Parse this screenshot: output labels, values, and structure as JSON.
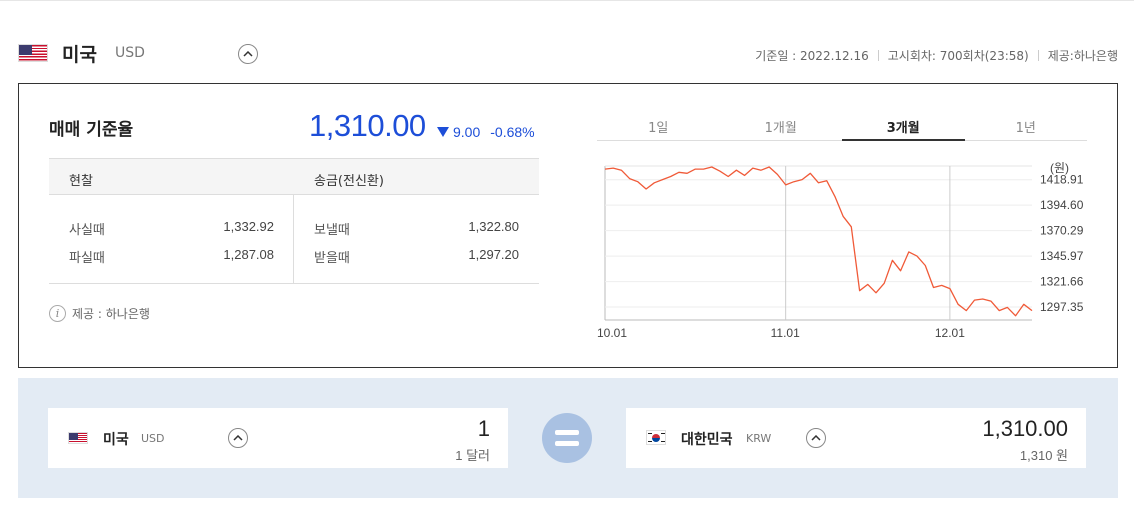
{
  "header": {
    "country": "미국",
    "code": "USD",
    "base_date": "기준일 : 2022.12.16",
    "notice": "고시회차: 700회차(23:58)",
    "provider": "제공:하나은행"
  },
  "rate": {
    "title": "매매 기준율",
    "value": "1,310.00",
    "change": "9.00",
    "change_pct": "-0.68%"
  },
  "table": {
    "headers": [
      "현찰",
      "송금(전신환)"
    ],
    "rows": [
      {
        "cash_label": "사실때",
        "cash_value": "1,332.92",
        "wire_label": "보낼때",
        "wire_value": "1,322.80"
      },
      {
        "cash_label": "파실때",
        "cash_value": "1,287.08",
        "wire_label": "받을때",
        "wire_value": "1,297.20"
      }
    ]
  },
  "provider_note": "제공 : 하나은행",
  "tabs": [
    {
      "label": "1일",
      "active": false
    },
    {
      "label": "1개월",
      "active": false
    },
    {
      "label": "3개월",
      "active": true
    },
    {
      "label": "1년",
      "active": false
    }
  ],
  "chart_data": {
    "type": "line",
    "ylabel": "(원)",
    "y_ticks": [
      1418.91,
      1394.6,
      1370.29,
      1345.97,
      1321.66,
      1297.35
    ],
    "y_tick_labels": [
      "1418.91",
      "1394.60",
      "1370.29",
      "1345.97",
      "1321.66",
      "1297.35"
    ],
    "ylim": [
      1285,
      1432
    ],
    "x_tick_labels": [
      "10.01",
      "11.01",
      "12.01"
    ],
    "x_ticks_index": [
      0,
      22,
      42
    ],
    "series": [
      {
        "color": "#f05a38",
        "values": [
          1429,
          1430,
          1428,
          1420,
          1417,
          1410,
          1416,
          1419,
          1422,
          1426,
          1425,
          1429,
          1429,
          1431,
          1427,
          1422,
          1428,
          1423,
          1430,
          1428,
          1431,
          1424,
          1414,
          1417,
          1419,
          1425,
          1416,
          1418,
          1403,
          1384,
          1374,
          1313,
          1319,
          1311,
          1320,
          1342,
          1332,
          1350,
          1346,
          1337,
          1316,
          1318,
          1315,
          1300,
          1294,
          1304,
          1305,
          1303,
          1294,
          1297,
          1289,
          1300,
          1294
        ]
      }
    ]
  },
  "converter": {
    "from": {
      "country": "미국",
      "code": "USD",
      "amount": "1",
      "unit_text": "1 달러"
    },
    "to": {
      "country": "대한민국",
      "code": "KRW",
      "amount": "1,310.00",
      "unit_text": "1,310 원"
    }
  },
  "colors": {
    "accent_blue": "#1d4ed8",
    "line": "#f05a38",
    "converter_bg": "#e3ebf4"
  }
}
